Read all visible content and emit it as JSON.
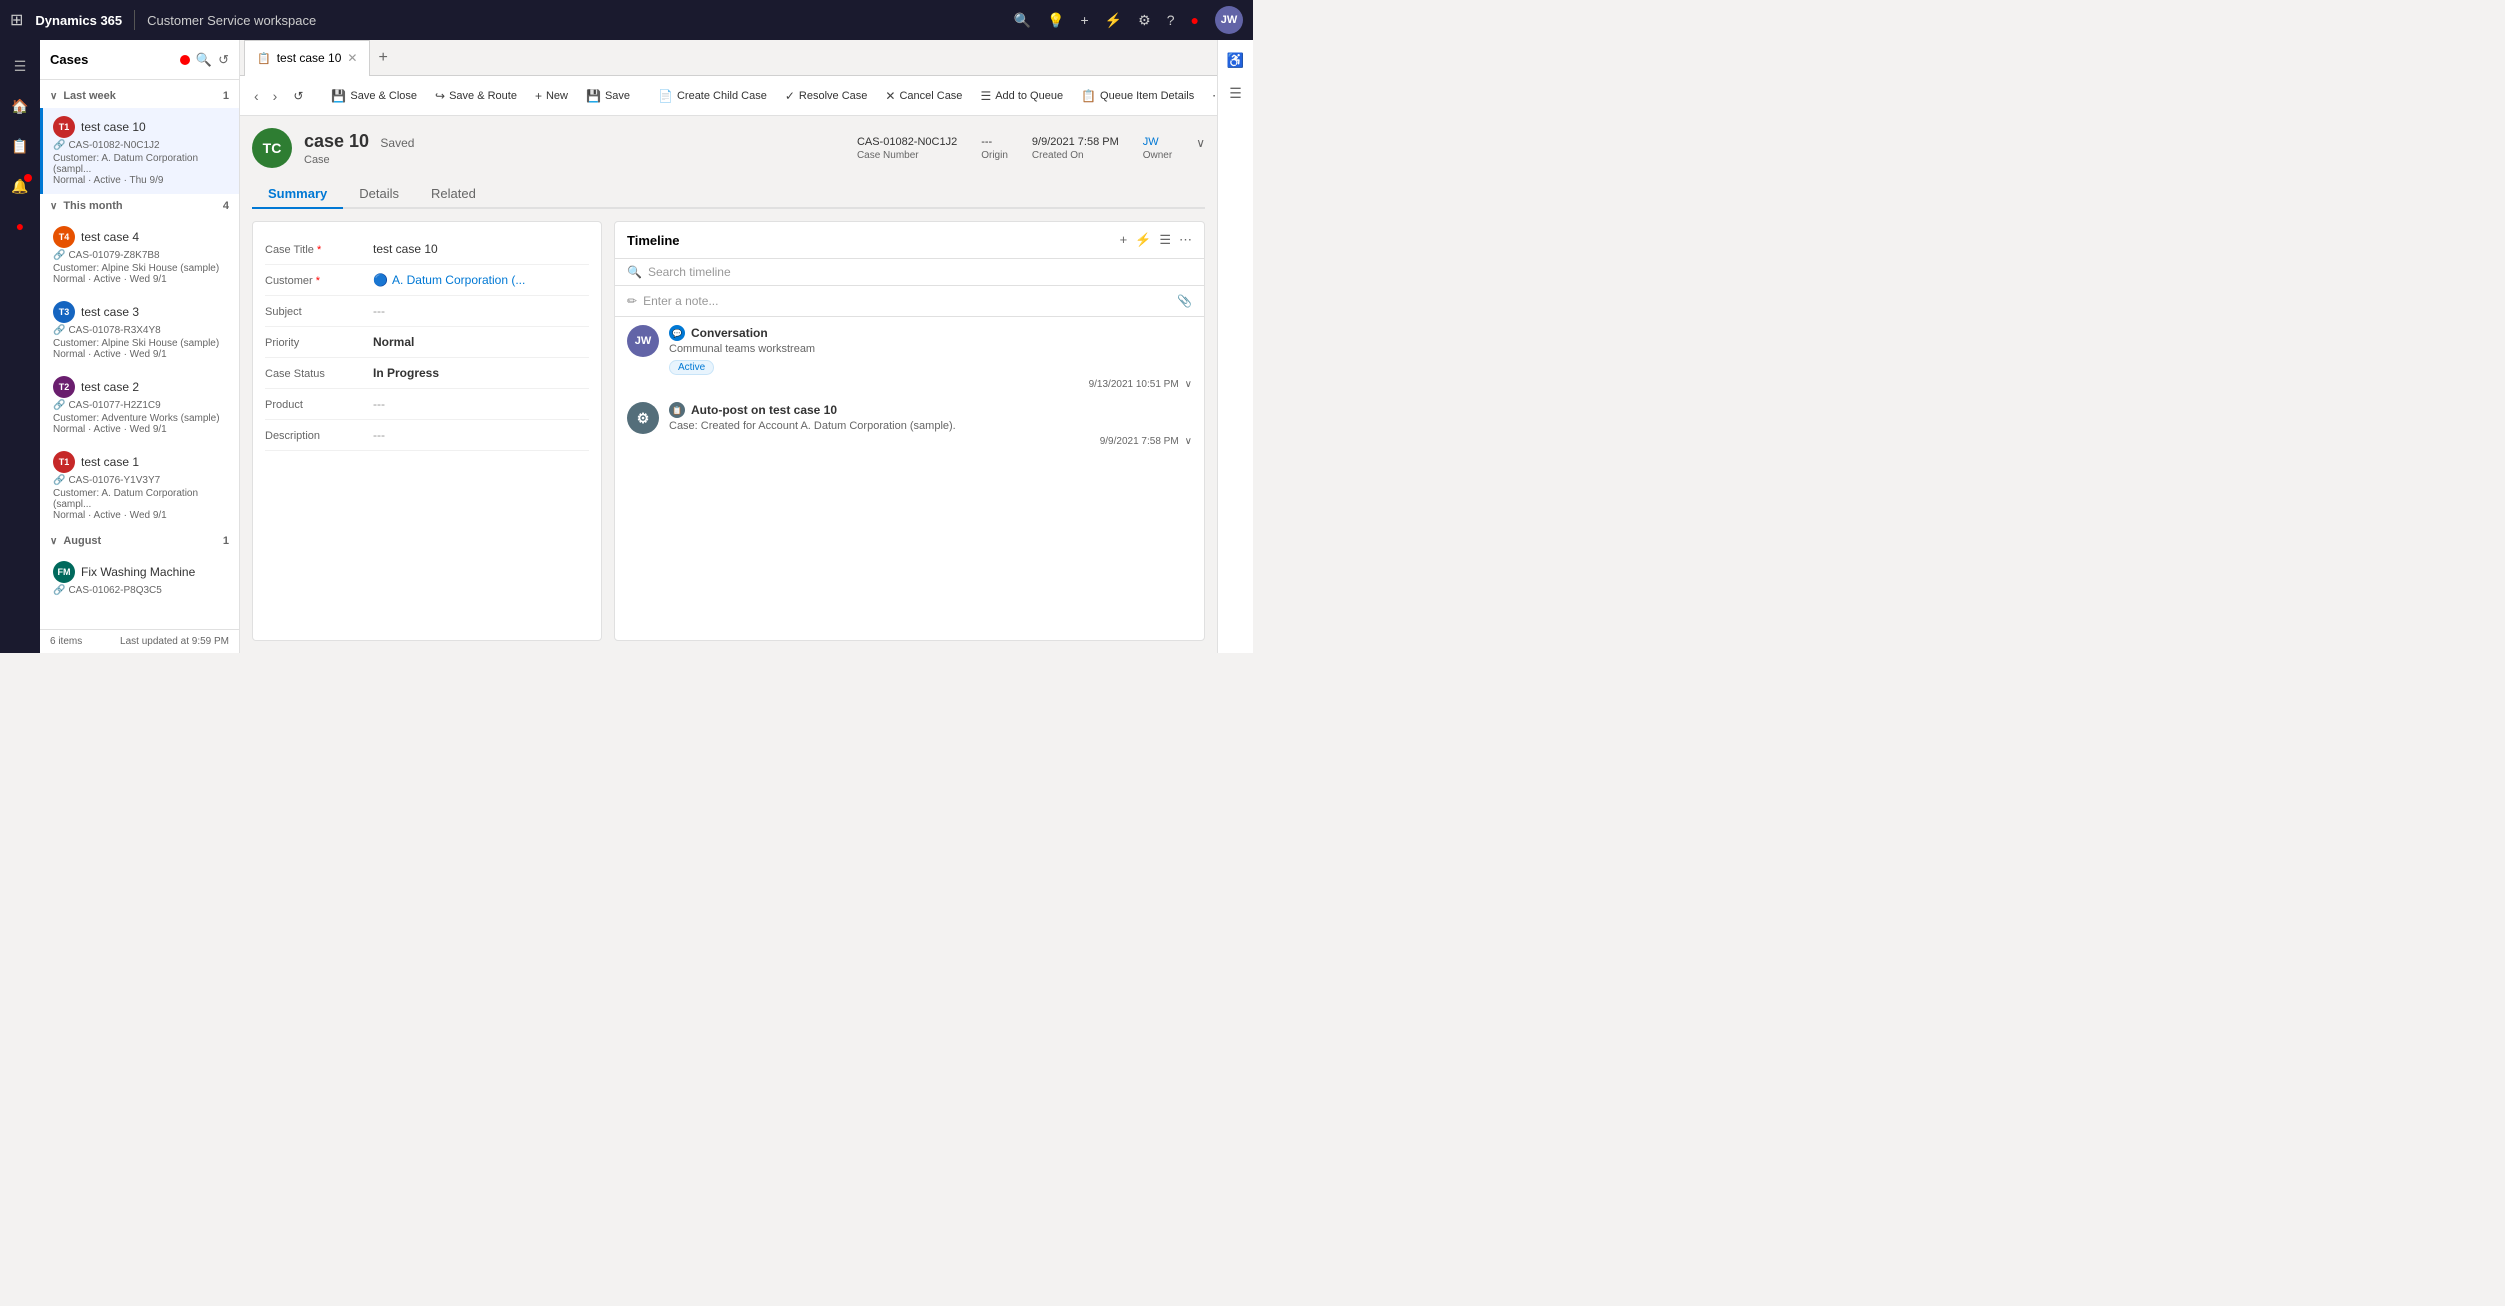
{
  "topNav": {
    "brand": "Dynamics 365",
    "divider": "|",
    "module": "Customer Service workspace",
    "userInitials": "JW",
    "userBg": "#6264a7"
  },
  "sidebar": {
    "icons": [
      "grid",
      "home",
      "bell",
      "bookmark",
      "red-dot"
    ]
  },
  "casesPanel": {
    "title": "Cases",
    "groups": [
      {
        "name": "Last week",
        "collapsed": false,
        "count": "1",
        "items": [
          {
            "id": "case-10",
            "name": "test case 10",
            "caseId": "CAS-01082-N0C1J2",
            "customer": "A. Datum Corporation (sampl...",
            "meta": "Normal · Active · Thu 9/9",
            "avatarBg": "#c62828",
            "avatarText": "T1",
            "selected": true
          }
        ]
      },
      {
        "name": "This month",
        "collapsed": false,
        "count": "4",
        "items": [
          {
            "id": "case-4",
            "name": "test case 4",
            "caseId": "CAS-01079-Z8K7B8",
            "customer": "Customer: Alpine Ski House (sample)",
            "meta": "Normal · Active · Wed 9/1",
            "avatarBg": "#e65100",
            "avatarText": "T4",
            "selected": false
          },
          {
            "id": "case-3",
            "name": "test case 3",
            "caseId": "CAS-01078-R3X4Y8",
            "customer": "Customer: Alpine Ski House (sample)",
            "meta": "Normal · Active · Wed 9/1",
            "avatarBg": "#1565c0",
            "avatarText": "T3",
            "selected": false
          },
          {
            "id": "case-2",
            "name": "test case 2",
            "caseId": "CAS-01077-H2Z1C9",
            "customer": "Customer: Adventure Works (sample)",
            "meta": "Normal · Active · Wed 9/1",
            "avatarBg": "#6a1e6e",
            "avatarText": "T2",
            "selected": false
          },
          {
            "id": "case-1",
            "name": "test case 1",
            "caseId": "CAS-01076-Y1V3Y7",
            "customer": "Customer: A. Datum Corporation (sampl...",
            "meta": "Normal · Active · Wed 9/1",
            "avatarBg": "#c62828",
            "avatarText": "T1",
            "selected": false
          }
        ]
      },
      {
        "name": "August",
        "collapsed": false,
        "count": "1",
        "items": [
          {
            "id": "fix-washing",
            "name": "Fix Washing Machine",
            "caseId": "CAS-01062-P8Q3C5",
            "customer": "",
            "meta": "",
            "avatarBg": "#00695c",
            "avatarText": "FM",
            "selected": false
          }
        ]
      }
    ],
    "footer": {
      "items": "6 items",
      "updated": "Last updated at 9:59 PM"
    }
  },
  "tab": {
    "label": "test case 10",
    "addLabel": "+"
  },
  "toolbar": {
    "back": "‹",
    "forward": "›",
    "refresh": "↺",
    "saveClose": "Save & Close",
    "saveRoute": "Save & Route",
    "new": "New",
    "save": "Save",
    "createChild": "Create Child Case",
    "resolveCase": "Resolve Case",
    "cancelCase": "Cancel Case",
    "addToQueue": "Add to Queue",
    "queueDetails": "Queue Item Details",
    "more": "⋯"
  },
  "caseDetail": {
    "avatarText": "TC",
    "avatarBg": "#2e7d32",
    "caseName": "case 10",
    "savedStatus": "Saved",
    "type": "Case",
    "caseNumber": "CAS-01082-N0C1J2",
    "caseNumberLabel": "Case Number",
    "origin": "---",
    "originLabel": "Origin",
    "createdOn": "9/9/2021 7:58 PM",
    "createdOnLabel": "Created On",
    "owner": "JW",
    "ownerLabel": "Owner",
    "tabs": [
      "Summary",
      "Details",
      "Related"
    ],
    "activeTab": "Summary"
  },
  "form": {
    "fields": [
      {
        "label": "Case Title",
        "required": true,
        "value": "test case 10",
        "type": "text"
      },
      {
        "label": "Customer",
        "required": true,
        "value": "A. Datum Corporation (...",
        "type": "link"
      },
      {
        "label": "Subject",
        "required": false,
        "value": "---",
        "type": "dash"
      },
      {
        "label": "Priority",
        "required": false,
        "value": "Normal",
        "type": "bold"
      },
      {
        "label": "Case Status",
        "required": false,
        "value": "In Progress",
        "type": "bold"
      },
      {
        "label": "Product",
        "required": false,
        "value": "---",
        "type": "dash"
      },
      {
        "label": "Description",
        "required": false,
        "value": "---",
        "type": "dash"
      }
    ]
  },
  "timeline": {
    "title": "Timeline",
    "searchPlaceholder": "Search timeline",
    "notePlaceholder": "Enter a note...",
    "entries": [
      {
        "id": "conv-1",
        "avatarText": "JW",
        "avatarBg": "#6264a7",
        "typeIcon": "💬",
        "typeLabel": "Conversation",
        "title": "Conversation",
        "subtitle": "Communal teams workstream",
        "badge": "Active",
        "time": "9/13/2021 10:51 PM",
        "hasExpand": true
      },
      {
        "id": "auto-post",
        "avatarText": "⚙",
        "avatarBg": "#546e7a",
        "typeIcon": "📋",
        "typeLabel": "Auto-post",
        "title": "Auto-post on test case 10",
        "subtitle": "Case: Created for Account A. Datum Corporation (sample).",
        "badge": "",
        "time": "9/9/2021 7:58 PM",
        "hasExpand": true
      }
    ]
  },
  "rightPanel": {
    "icons": [
      "accessibility",
      "list"
    ]
  }
}
